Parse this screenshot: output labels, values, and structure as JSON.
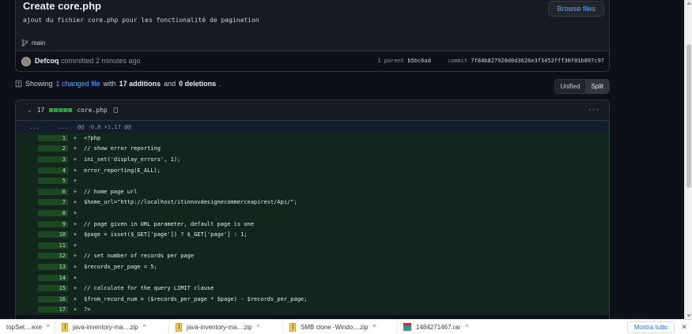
{
  "commit": {
    "title": "Create core.php",
    "description": "ajout du fichier core.php pour les fonctionalité de pagination",
    "branch": "main",
    "browse_label": "Browse files",
    "author": "Defcoq",
    "action": "committed 2 minutes ago",
    "parent_label": "1 parent",
    "parent_hash": "b5bc6ad",
    "commit_label": "commit",
    "commit_hash": "7f84b827920d0d3626e3f3452fff30f01b897c97"
  },
  "summary": {
    "showing": "Showing",
    "changed": "1 changed file",
    "with": "with",
    "additions": "17 additions",
    "and": "and",
    "deletions": "0 deletions",
    "period": "."
  },
  "view_toggle": {
    "unified": "Unified",
    "split": "Split",
    "active": "split"
  },
  "file": {
    "count": "17",
    "name": "core.php",
    "hunk_n1": "...",
    "hunk_n2": "...",
    "hunk_header": "@@ -0,0 +1,17 @@",
    "lines": [
      {
        "n": "1",
        "code": "<?php"
      },
      {
        "n": "2",
        "code": "// show error reporting"
      },
      {
        "n": "3",
        "code": "ini_set('display_errors', 1);"
      },
      {
        "n": "4",
        "code": "error_reporting(E_ALL);"
      },
      {
        "n": "5",
        "code": ""
      },
      {
        "n": "6",
        "code": "// home page url"
      },
      {
        "n": "7",
        "code": "$home_url=\"http://localhost/itinnovdesignecommerceapirest/Api/\";"
      },
      {
        "n": "8",
        "code": ""
      },
      {
        "n": "9",
        "code": "// page given in URL parameter, default page is one"
      },
      {
        "n": "10",
        "code": "$page = isset($_GET['page']) ? $_GET['page'] : 1;"
      },
      {
        "n": "11",
        "code": ""
      },
      {
        "n": "12",
        "code": "// set number of records per page"
      },
      {
        "n": "13",
        "code": "$records_per_page = 5;"
      },
      {
        "n": "14",
        "code": ""
      },
      {
        "n": "15",
        "code": "// calculate for the query LIMIT clause"
      },
      {
        "n": "16",
        "code": "$from_record_num = ($records_per_page * $page) - $records_per_page;"
      },
      {
        "n": "17",
        "code": "?>"
      }
    ]
  },
  "downloads": {
    "items": [
      {
        "name": "topSet....exe",
        "icon": "exe-file-icon"
      },
      {
        "name": "java-inventory-ma....zip",
        "icon": "zip-file-icon"
      },
      {
        "name": "java-inventory-ma....zip",
        "icon": "zip-file-icon"
      },
      {
        "name": "SMB clone -Windo....zip",
        "icon": "zip-file-icon"
      },
      {
        "name": "1484271467.rar",
        "icon": "rar-file-icon"
      }
    ],
    "show_all": "Mostra tutto"
  }
}
